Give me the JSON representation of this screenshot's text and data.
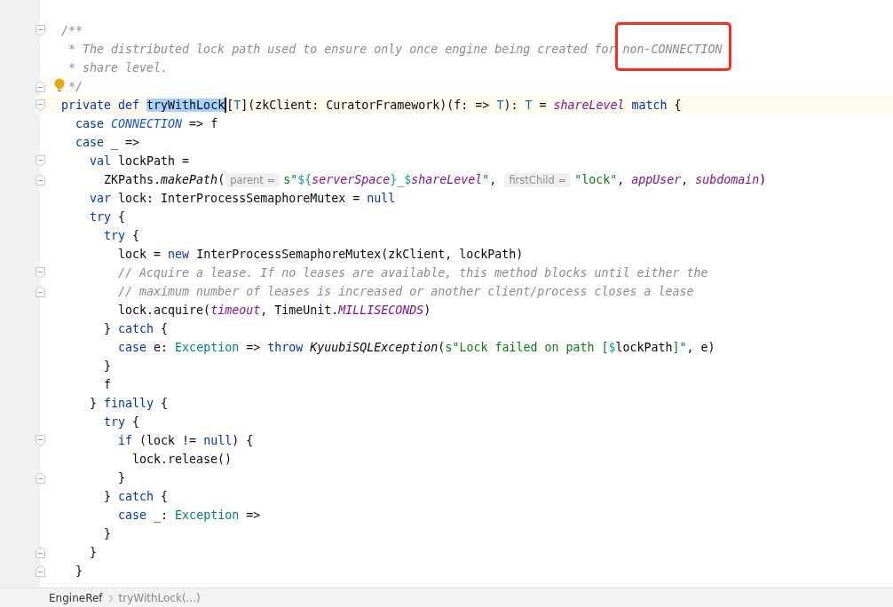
{
  "editor": {
    "lines": [
      {
        "current": false,
        "fold_start": true,
        "tokens": [
          {
            "kind": "comment",
            "text": "/**"
          }
        ]
      },
      {
        "current": false,
        "tokens": [
          {
            "kind": "comment",
            "text": " * The distributed lock path used to ensure only once engine being created for "
          },
          {
            "kind": "comment",
            "text": "non-CONNECTION",
            "boxed": true
          }
        ]
      },
      {
        "current": false,
        "tokens": [
          {
            "kind": "comment",
            "text": " * share level."
          }
        ]
      },
      {
        "current": false,
        "fold_end": true,
        "bulb": true,
        "tokens": [
          {
            "kind": "comment",
            "text": " */"
          }
        ]
      },
      {
        "current": true,
        "fold_start": true,
        "tokens": [
          {
            "kind": "keyword",
            "text": "private def "
          },
          {
            "kind": "plain",
            "text": "tryWithLock",
            "selected": true,
            "caret": true
          },
          {
            "kind": "plain",
            "text": "["
          },
          {
            "kind": "type",
            "text": "T"
          },
          {
            "kind": "plain",
            "text": "](zkClient: CuratorFramework)(f: => "
          },
          {
            "kind": "type",
            "text": "T"
          },
          {
            "kind": "plain",
            "text": "): "
          },
          {
            "kind": "type",
            "text": "T"
          },
          {
            "kind": "plain",
            "text": " = "
          },
          {
            "kind": "field",
            "text": "shareLevel"
          },
          {
            "kind": "keyword",
            "text": " match"
          },
          {
            "kind": "plain",
            "text": " {"
          }
        ]
      },
      {
        "current": false,
        "tokens": [
          {
            "kind": "keyword",
            "text": "  case "
          },
          {
            "kind": "constant",
            "text": "CONNECTION"
          },
          {
            "kind": "plain",
            "text": " => f"
          }
        ]
      },
      {
        "current": false,
        "tokens": [
          {
            "kind": "keyword",
            "text": "  case"
          },
          {
            "kind": "plain",
            "text": " _ =>"
          }
        ]
      },
      {
        "current": false,
        "fold_start": true,
        "tokens": [
          {
            "kind": "keyword",
            "text": "    val"
          },
          {
            "kind": "plain",
            "text": " lockPath ="
          }
        ]
      },
      {
        "current": false,
        "fold_end": true,
        "tokens": [
          {
            "kind": "plain",
            "text": "      ZKPaths."
          },
          {
            "kind": "italic",
            "text": "makePath"
          },
          {
            "kind": "plain",
            "text": "("
          },
          {
            "kind": "hint",
            "text": "parent ="
          },
          {
            "kind": "string",
            "text": "s\""
          },
          {
            "kind": "interp",
            "text": "${"
          },
          {
            "kind": "field",
            "text": "serverSpace"
          },
          {
            "kind": "interp",
            "text": "}"
          },
          {
            "kind": "string",
            "text": "_"
          },
          {
            "kind": "interp",
            "text": "$"
          },
          {
            "kind": "field",
            "text": "shareLevel"
          },
          {
            "kind": "string",
            "text": "\""
          },
          {
            "kind": "plain",
            "text": ", "
          },
          {
            "kind": "hint",
            "text": "firstChild ="
          },
          {
            "kind": "string",
            "text": "\"lock\""
          },
          {
            "kind": "plain",
            "text": ", "
          },
          {
            "kind": "field",
            "text": "appUser"
          },
          {
            "kind": "plain",
            "text": ", "
          },
          {
            "kind": "field",
            "text": "subdomain"
          },
          {
            "kind": "plain",
            "text": ")"
          }
        ]
      },
      {
        "current": false,
        "tokens": [
          {
            "kind": "keyword",
            "text": "    var"
          },
          {
            "kind": "plain",
            "text": " lock: InterProcessSemaphoreMutex = "
          },
          {
            "kind": "keyword",
            "text": "null"
          }
        ]
      },
      {
        "current": false,
        "tokens": [
          {
            "kind": "keyword",
            "text": "    try"
          },
          {
            "kind": "plain",
            "text": " {"
          }
        ]
      },
      {
        "current": false,
        "tokens": [
          {
            "kind": "keyword",
            "text": "      try"
          },
          {
            "kind": "plain",
            "text": " {"
          }
        ]
      },
      {
        "current": false,
        "tokens": [
          {
            "kind": "plain",
            "text": "        lock = "
          },
          {
            "kind": "keyword",
            "text": "new"
          },
          {
            "kind": "plain",
            "text": " InterProcessSemaphoreMutex(zkClient, lockPath)"
          }
        ]
      },
      {
        "current": false,
        "fold_start": true,
        "tokens": [
          {
            "kind": "comment",
            "text": "        // Acquire a lease. If no leases are available, this method blocks until either the"
          }
        ]
      },
      {
        "current": false,
        "fold_end": true,
        "tokens": [
          {
            "kind": "comment",
            "text": "        // maximum number of leases is increased or another client/process closes a lease"
          }
        ]
      },
      {
        "current": false,
        "tokens": [
          {
            "kind": "plain",
            "text": "        lock.acquire("
          },
          {
            "kind": "field",
            "text": "timeout"
          },
          {
            "kind": "plain",
            "text": ", TimeUnit."
          },
          {
            "kind": "field",
            "text": "MILLISECONDS"
          },
          {
            "kind": "plain",
            "text": ")"
          }
        ]
      },
      {
        "current": false,
        "tokens": [
          {
            "kind": "plain",
            "text": "      } "
          },
          {
            "kind": "keyword",
            "text": "catch"
          },
          {
            "kind": "plain",
            "text": " {"
          }
        ]
      },
      {
        "current": false,
        "tokens": [
          {
            "kind": "keyword",
            "text": "        case"
          },
          {
            "kind": "plain",
            "text": " e: "
          },
          {
            "kind": "type",
            "text": "Exception"
          },
          {
            "kind": "plain",
            "text": " => "
          },
          {
            "kind": "keyword",
            "text": "throw "
          },
          {
            "kind": "italic",
            "text": "KyuubiSQLException"
          },
          {
            "kind": "plain",
            "text": "("
          },
          {
            "kind": "string",
            "text": "s\"Lock failed on path ["
          },
          {
            "kind": "interp",
            "text": "$"
          },
          {
            "kind": "plain",
            "text": "lockPath"
          },
          {
            "kind": "string",
            "text": "]\""
          },
          {
            "kind": "plain",
            "text": ", e)"
          }
        ]
      },
      {
        "current": false,
        "tokens": [
          {
            "kind": "plain",
            "text": "      }"
          }
        ]
      },
      {
        "current": false,
        "tokens": [
          {
            "kind": "plain",
            "text": "      f"
          }
        ]
      },
      {
        "current": false,
        "tokens": [
          {
            "kind": "plain",
            "text": "    } "
          },
          {
            "kind": "keyword",
            "text": "finally"
          },
          {
            "kind": "plain",
            "text": " {"
          }
        ]
      },
      {
        "current": false,
        "tokens": [
          {
            "kind": "keyword",
            "text": "      try"
          },
          {
            "kind": "plain",
            "text": " {"
          }
        ]
      },
      {
        "current": false,
        "fold_start": true,
        "tokens": [
          {
            "kind": "keyword",
            "text": "        if"
          },
          {
            "kind": "plain",
            "text": " (lock != "
          },
          {
            "kind": "keyword",
            "text": "null"
          },
          {
            "kind": "plain",
            "text": ") {"
          }
        ]
      },
      {
        "current": false,
        "tokens": [
          {
            "kind": "plain",
            "text": "          lock.release()"
          }
        ]
      },
      {
        "current": false,
        "fold_end": true,
        "tokens": [
          {
            "kind": "plain",
            "text": "        }"
          }
        ]
      },
      {
        "current": false,
        "tokens": [
          {
            "kind": "plain",
            "text": "      } "
          },
          {
            "kind": "keyword",
            "text": "catch"
          },
          {
            "kind": "plain",
            "text": " {"
          }
        ]
      },
      {
        "current": false,
        "tokens": [
          {
            "kind": "keyword",
            "text": "        case"
          },
          {
            "kind": "plain",
            "text": " _: "
          },
          {
            "kind": "type",
            "text": "Exception"
          },
          {
            "kind": "plain",
            "text": " =>"
          }
        ]
      },
      {
        "current": false,
        "tokens": [
          {
            "kind": "plain",
            "text": "      }"
          }
        ]
      },
      {
        "current": false,
        "fold_end": true,
        "tokens": [
          {
            "kind": "plain",
            "text": "    }"
          }
        ]
      },
      {
        "current": false,
        "fold_end": true,
        "tokens": [
          {
            "kind": "plain",
            "text": "  }"
          }
        ]
      }
    ]
  },
  "breadcrumbs": [
    {
      "label": "EngineRef"
    },
    {
      "label": "tryWithLock(...)"
    }
  ]
}
